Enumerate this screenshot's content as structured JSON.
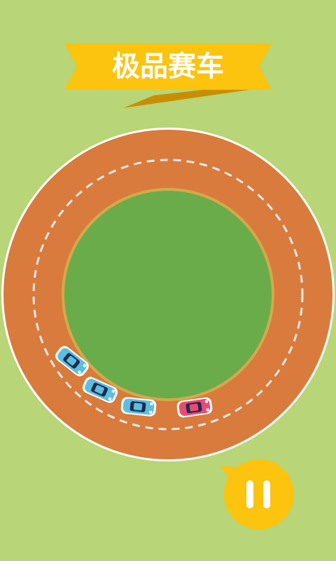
{
  "banner": {
    "title": "极品赛车"
  },
  "colors": {
    "background": "#b8d577",
    "track": "#d97b3c",
    "track_edge": "#ffffff",
    "lane_dash": "#e8e8e8",
    "infield": "#6aac49",
    "infield_rim": "#d4a94d",
    "banner": "#fcc30f",
    "banner_dark": "#c98e00",
    "banner_text": "#ffffff",
    "pause_button": "#fcc30f",
    "pause_icon": "#ffffff",
    "player_car": "#e84a74",
    "opponent_car": "#5bbfe2",
    "opponent_car_accent": "#2f9ed6"
  },
  "cars": [
    {
      "name": "opponent-car-1",
      "role": "opponent"
    },
    {
      "name": "opponent-car-2",
      "role": "opponent"
    },
    {
      "name": "opponent-car-3",
      "role": "opponent"
    },
    {
      "name": "player-car",
      "role": "player"
    }
  ],
  "controls": {
    "pause_icon": "pause-icon"
  }
}
